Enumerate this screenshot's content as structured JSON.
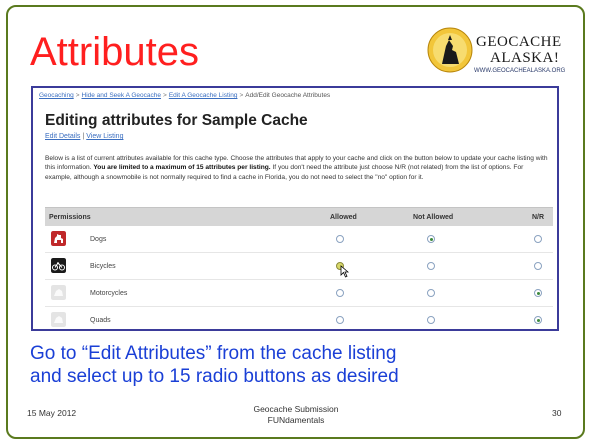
{
  "slide": {
    "title": "Attributes",
    "logo": {
      "line1": "GEOCACHE",
      "line2": "ALASKA!",
      "url": "WWW.GEOCACHEALASKA.ORG"
    },
    "caption_line1": "Go to “Edit Attributes” from the cache listing",
    "caption_line2": "and select up to 15 radio buttons as desired",
    "footer": {
      "date": "15 May 2012",
      "center_line1": "Geocache Submission",
      "center_line2": "FUNdamentals",
      "page": "30"
    }
  },
  "screenshot": {
    "breadcrumb": [
      "Geocaching",
      "Hide and Seek A Geocache",
      "Edit A Geocache Listing",
      "Add/Edit Geocache Attributes"
    ],
    "heading": "Editing attributes for Sample Cache",
    "links": {
      "edit_details": "Edit Details",
      "separator": "|",
      "view_listing": "View Listing"
    },
    "intro_part1": "Below is a list of current attributes available for this cache type. Choose the attributes that apply to your cache and click on the button below to update your cache listing with this information.",
    "intro_bold": "You are limited to a maximum of 15 attributes per listing.",
    "intro_part2": "If you don't need the attribute just choose N/R (not related) from the list of options. For example, although a snowmobile is not normally required to find a cache in Florida, you do not need to select the \"no\" option for it.",
    "table": {
      "headers": {
        "name": "Permissions",
        "allowed": "Allowed",
        "not_allowed": "Not Allowed",
        "nr": "N/R"
      },
      "rows": [
        {
          "label": "Dogs",
          "icon": "dog-icon",
          "icon_color": "#c0282a",
          "selected": "not_allowed"
        },
        {
          "label": "Bicycles",
          "icon": "bicycle-icon",
          "icon_color": "#1a1a1a",
          "selected": "allowed-hover"
        },
        {
          "label": "Motorcycles",
          "icon": "motorcycle-icon",
          "icon_color": "#e4e4e4",
          "selected": "nr"
        },
        {
          "label": "Quads",
          "icon": "quad-icon",
          "icon_color": "#e4e4e4",
          "selected": "nr"
        }
      ]
    }
  },
  "colors": {
    "title": "#ff1f1f",
    "caption": "#1a3fd6",
    "frame": "#5a7a1e",
    "panel_border": "#3b3b9a",
    "link": "#3a6ec0"
  }
}
